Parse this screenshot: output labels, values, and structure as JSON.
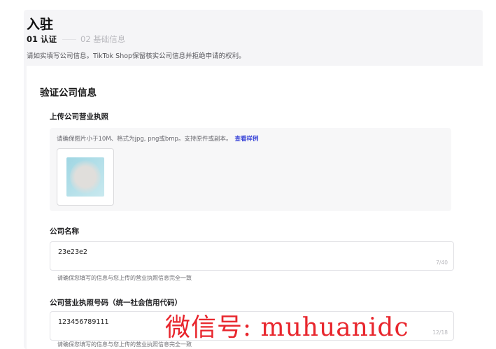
{
  "page": {
    "title": "入驻"
  },
  "steps": [
    {
      "label": "01 认证",
      "active": true
    },
    {
      "label": "02 基础信息",
      "active": false
    }
  ],
  "description": "请如实填写公司信息。TikTok Shop保留核实公司信息并拒绝申请的权利。",
  "section": {
    "title": "验证公司信息"
  },
  "upload": {
    "label": "上传公司营业执照",
    "hint": "请确保图片小于10M、格式为jpg, png或bmp。支持原件或副本。",
    "example_link": "查看样例"
  },
  "company_name": {
    "label": "公司名称",
    "value": "23e23e2",
    "counter": "7/40",
    "help": "请确保您填写的信息与您上传的营业执照信息完全一致"
  },
  "license_number": {
    "label": "公司营业执照号码（统一社会信用代码）",
    "value": "123456789111",
    "counter": "12/18",
    "help": "请确保您填写的信息与您上传的营业执照信息完全一致"
  },
  "watermark": "微信号: muhuanidc"
}
